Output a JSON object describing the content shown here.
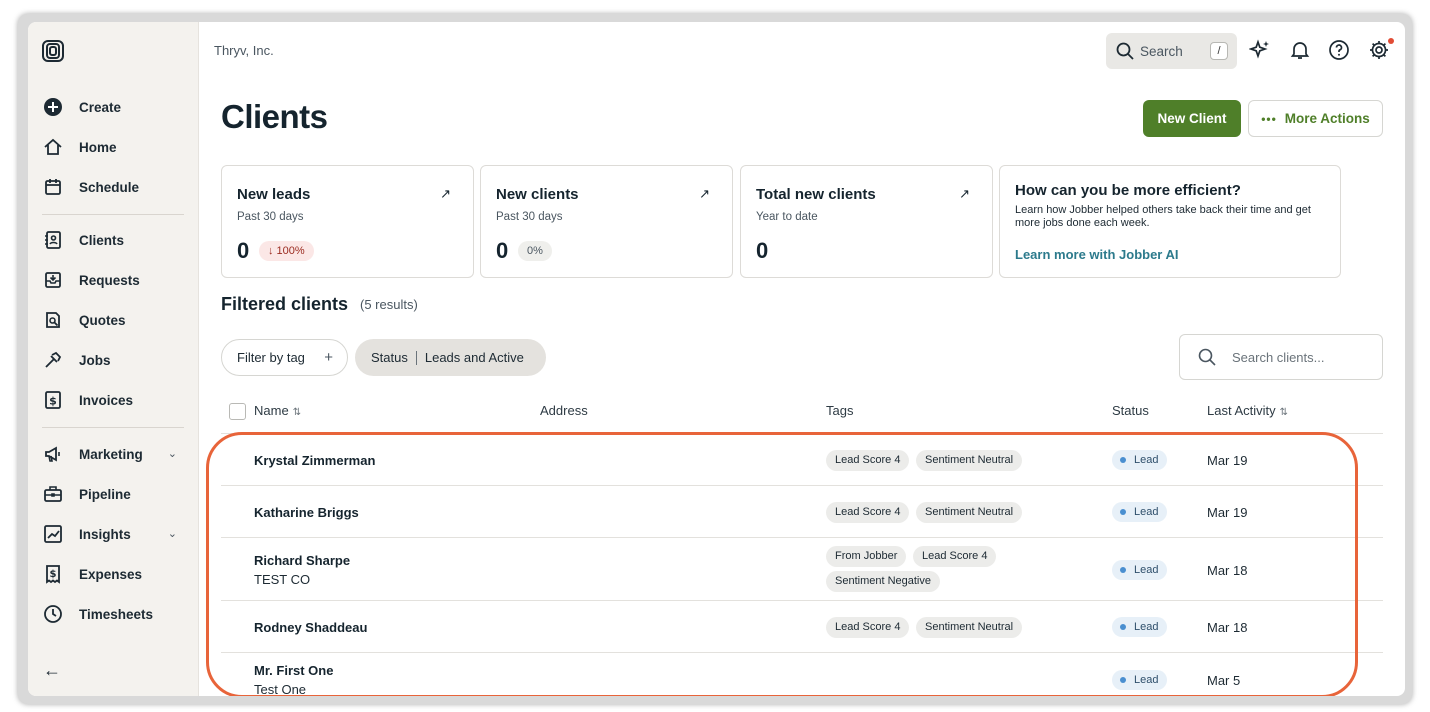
{
  "company": "Thryv, Inc.",
  "sidebar": {
    "items": [
      {
        "label": "Create",
        "icon": "plus-circle-icon"
      },
      {
        "label": "Home",
        "icon": "home-icon"
      },
      {
        "label": "Schedule",
        "icon": "calendar-icon"
      },
      {
        "label": "Clients",
        "icon": "clients-icon"
      },
      {
        "label": "Requests",
        "icon": "requests-icon"
      },
      {
        "label": "Quotes",
        "icon": "quotes-icon"
      },
      {
        "label": "Jobs",
        "icon": "hammer-icon"
      },
      {
        "label": "Invoices",
        "icon": "invoice-icon"
      },
      {
        "label": "Marketing",
        "icon": "megaphone-icon"
      },
      {
        "label": "Pipeline",
        "icon": "briefcase-icon"
      },
      {
        "label": "Insights",
        "icon": "chart-icon"
      },
      {
        "label": "Expenses",
        "icon": "receipt-icon"
      },
      {
        "label": "Timesheets",
        "icon": "clock-icon"
      }
    ]
  },
  "header": {
    "search_label": "Search",
    "search_shortcut": "/",
    "icons": [
      "sparkle-icon",
      "bell-icon",
      "help-icon",
      "gear-icon"
    ]
  },
  "page": {
    "title": "Clients",
    "new_client": "New Client",
    "more_actions": "More Actions"
  },
  "cards": [
    {
      "title": "New leads",
      "subtitle": "Past 30 days",
      "value": "0",
      "badge": "↓ 100%"
    },
    {
      "title": "New clients",
      "subtitle": "Past 30 days",
      "value": "0",
      "badge": "0%"
    },
    {
      "title": "Total new clients",
      "subtitle": "Year to date",
      "value": "0"
    }
  ],
  "promo": {
    "title": "How can you be more efficient?",
    "text": "Learn how Jobber helped others take back their time and get more jobs done each week.",
    "link": "Learn more with Jobber AI"
  },
  "filters": {
    "title": "Filtered clients",
    "count": "(5 results)",
    "filter_by_tag": "Filter by tag",
    "status_label": "Status",
    "status_value": "Leads and Active",
    "search_placeholder": "Search clients..."
  },
  "table": {
    "headers": {
      "name": "Name",
      "address": "Address",
      "tags": "Tags",
      "status": "Status",
      "last_activity": "Last Activity"
    },
    "rows": [
      {
        "name": "Krystal Zimmerman",
        "company": "",
        "tags": [
          "Lead Score 4",
          "Sentiment Neutral"
        ],
        "status": "Lead",
        "date": "Mar 19"
      },
      {
        "name": "Katharine Briggs",
        "company": "",
        "tags": [
          "Lead Score 4",
          "Sentiment Neutral"
        ],
        "status": "Lead",
        "date": "Mar 19"
      },
      {
        "name": "Richard Sharpe",
        "company": "TEST CO",
        "tags": [
          "From Jobber",
          "Lead Score 4",
          "Sentiment Negative"
        ],
        "status": "Lead",
        "date": "Mar 18"
      },
      {
        "name": "Rodney Shaddeau",
        "company": "",
        "tags": [
          "Lead Score 4",
          "Sentiment Neutral"
        ],
        "status": "Lead",
        "date": "Mar 18"
      },
      {
        "name": "Mr. First One",
        "company": "Test One",
        "tags": [],
        "status": "Lead",
        "date": "Mar 5"
      }
    ]
  },
  "colors": {
    "accent_green": "#4f7f29",
    "highlight": "#e8643a",
    "link_teal": "#2c7a8c"
  }
}
